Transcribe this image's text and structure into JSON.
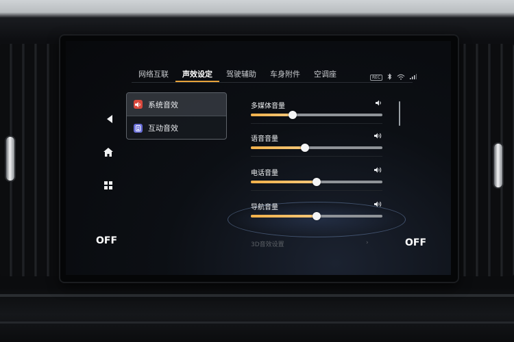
{
  "tabs": [
    {
      "label": "网络互联"
    },
    {
      "label": "声效设定"
    },
    {
      "label": "驾驶辅助"
    },
    {
      "label": "车身附件"
    },
    {
      "label": "空调座"
    }
  ],
  "status": {
    "rec_label": "REC"
  },
  "nav": {
    "back_icon": "◀",
    "home_icon": "home-icon",
    "apps_icon": "apps-icon"
  },
  "off_left": "OFF",
  "off_right": "OFF",
  "menu": {
    "items": [
      {
        "label": "系统音效"
      },
      {
        "label": "互动音效"
      }
    ]
  },
  "volumes": [
    {
      "label": "多媒体音量",
      "level": 0.32
    },
    {
      "label": "语音音量",
      "level": 0.41
    },
    {
      "label": "电话音量",
      "level": 0.5
    },
    {
      "label": "导航音量",
      "level": 0.5
    }
  ],
  "partial_row_label": "3D音效设置",
  "colors": {
    "accent": "#e8a33a",
    "fill": "#f2b14a"
  }
}
